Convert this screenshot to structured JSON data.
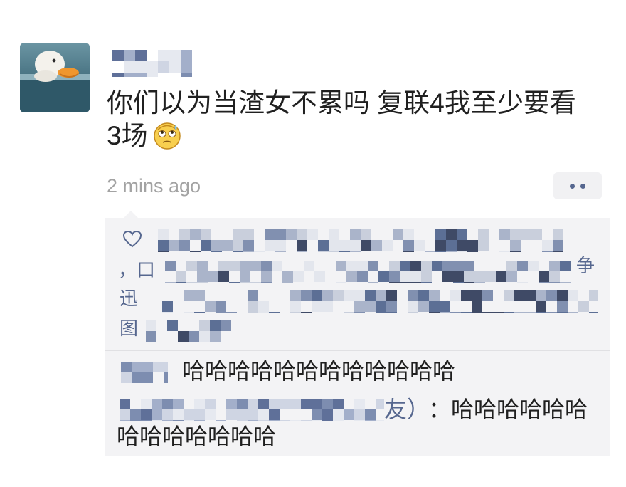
{
  "post": {
    "text_lines": [
      "你们以为当渣女不累吗 复联4我至少要看",
      "3场"
    ],
    "emoji": "flustered-emoji",
    "timestamp": "2 mins ago"
  },
  "icons": {
    "avatar": "duck-avatar",
    "more": "more-dots-icon",
    "like": "heart-icon"
  },
  "likes": {
    "fragments": [
      "，口",
      "迅",
      "图",
      "争"
    ]
  },
  "comments": [
    {
      "text_lines": [
        "哈哈哈哈哈哈哈哈哈哈哈哈"
      ]
    },
    {
      "name_suffix": "友）",
      "text_lines": [
        "：哈哈哈哈哈哈",
        "哈哈哈哈哈哈哈"
      ]
    }
  ],
  "colors": {
    "name_blue": "#56678f",
    "panel": "#f3f3f5",
    "timestamp": "#a3a3a3"
  }
}
